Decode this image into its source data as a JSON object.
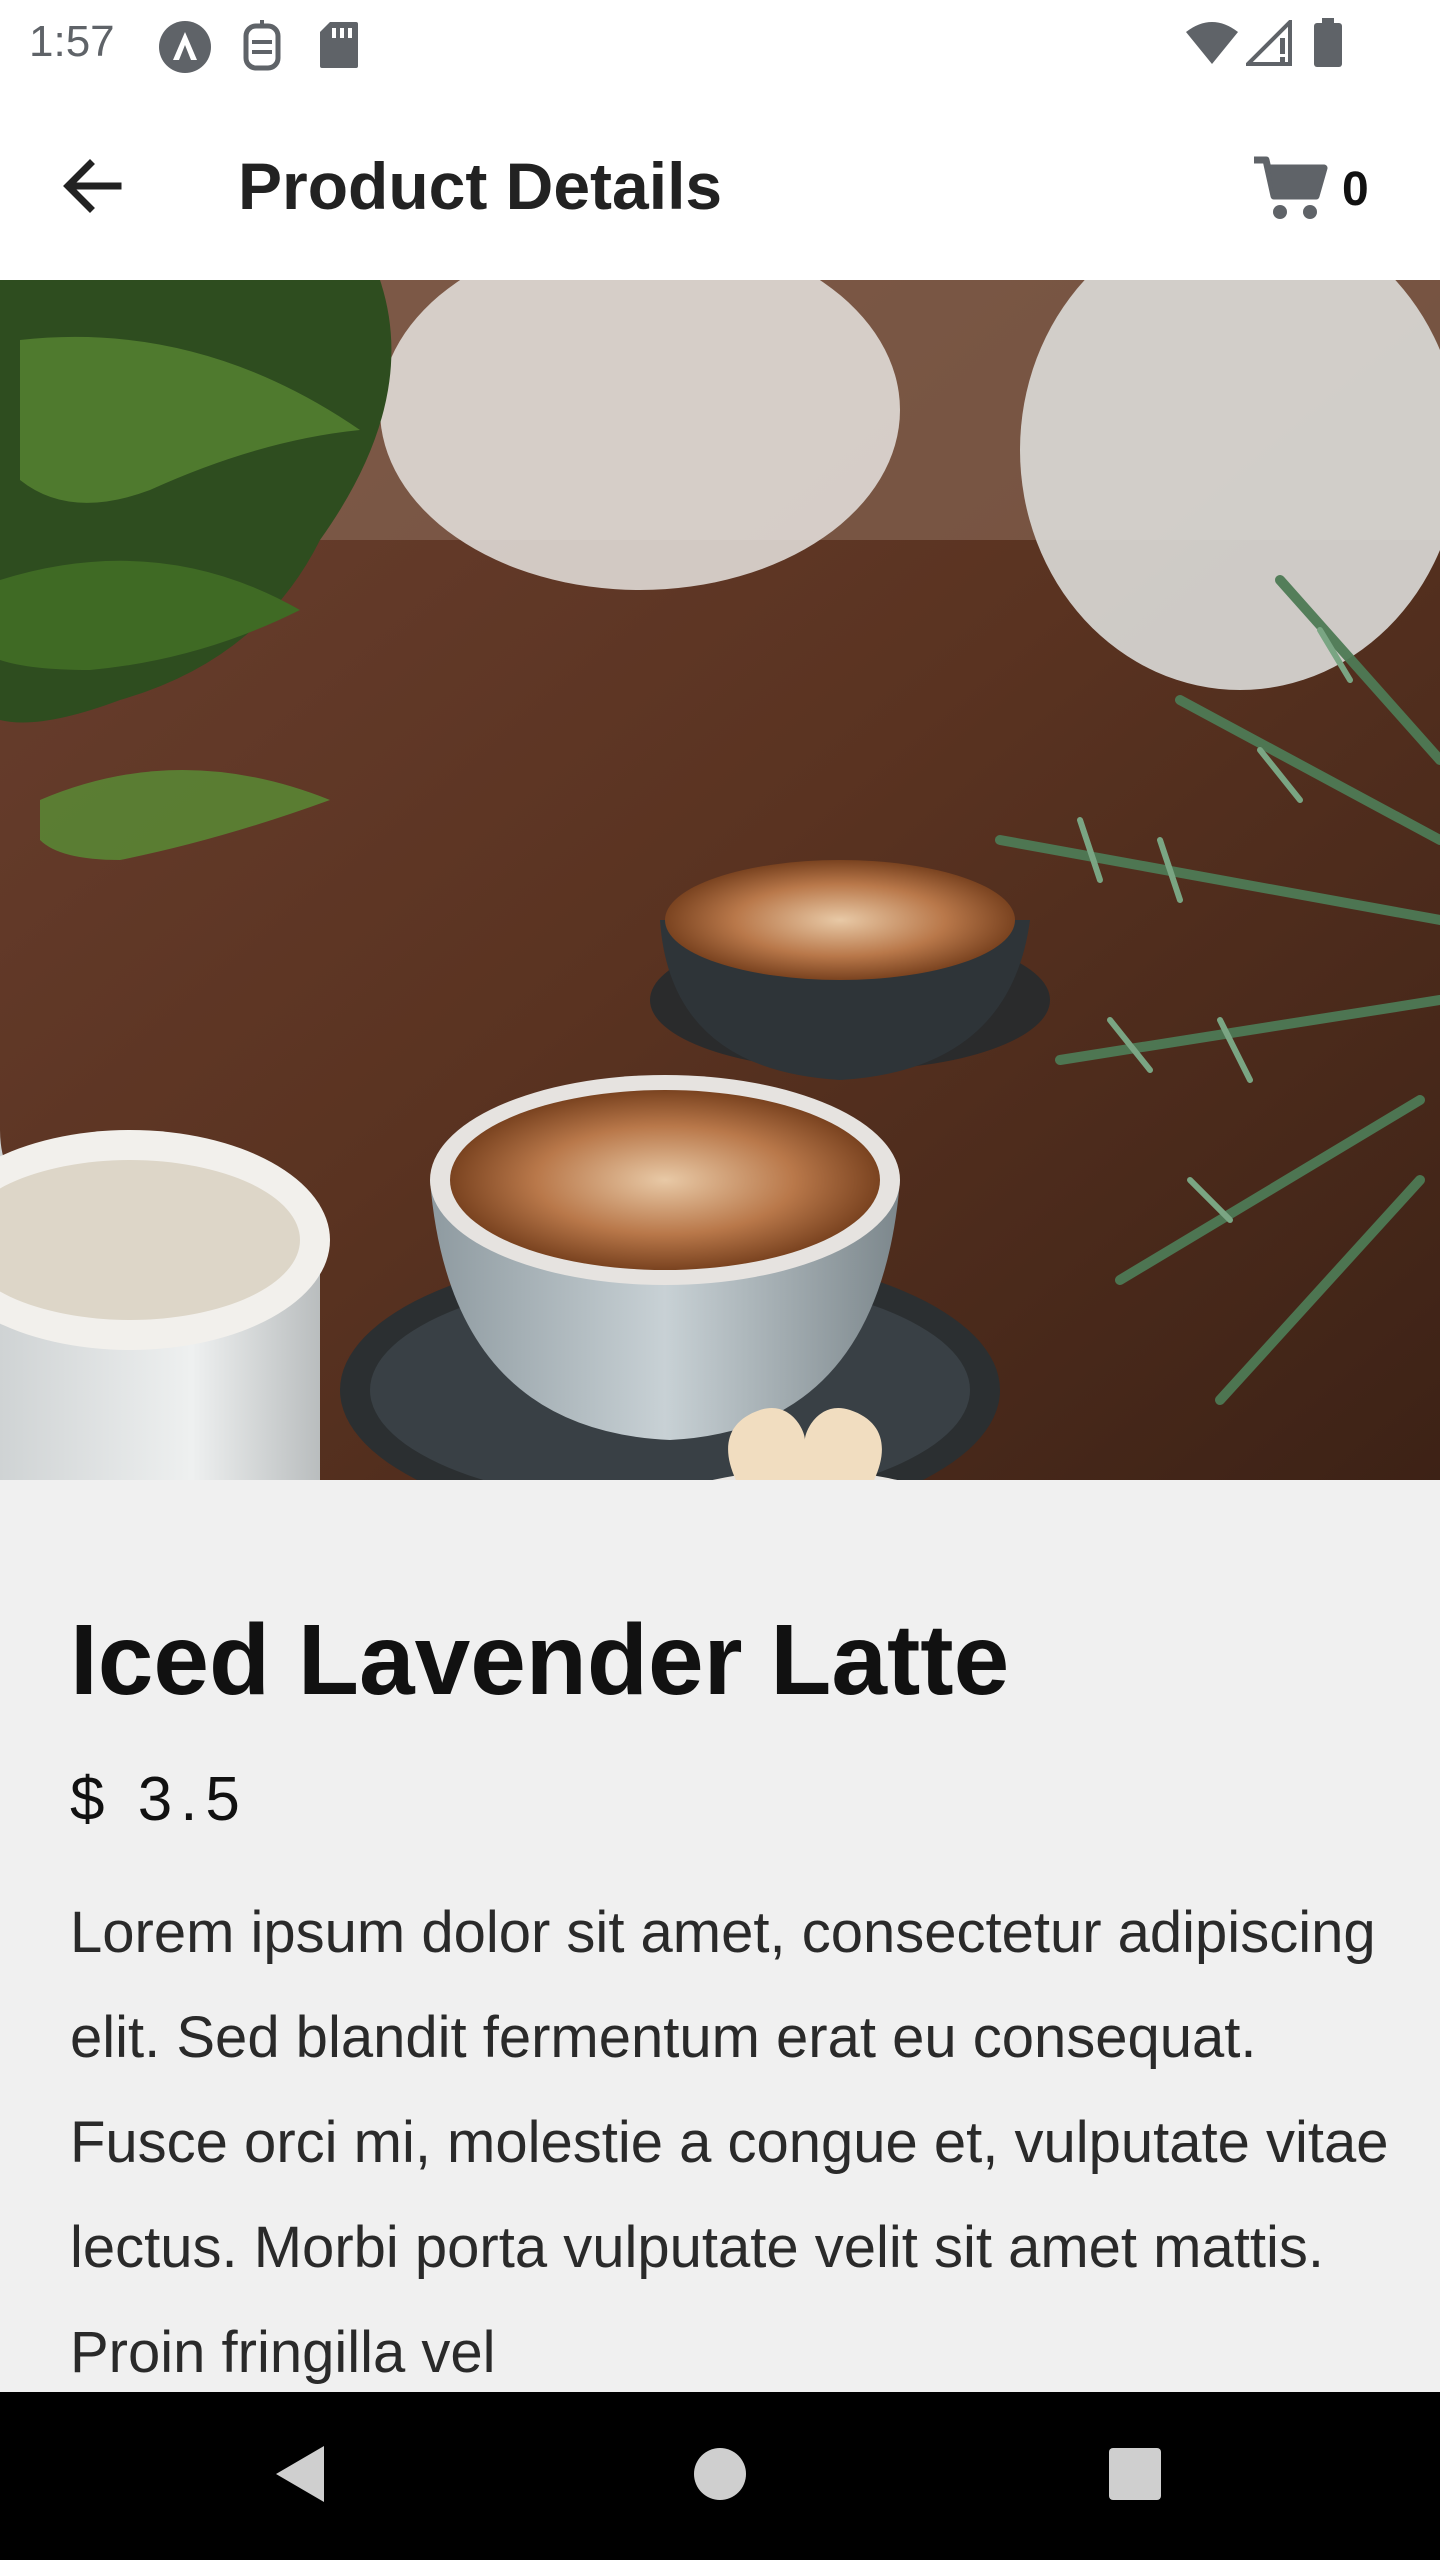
{
  "status_bar": {
    "time": "1:57",
    "icons": [
      "android-auto-icon",
      "sim-toolkit-icon",
      "sd-card-icon",
      "wifi-icon",
      "signal-icon",
      "battery-icon"
    ]
  },
  "app_bar": {
    "title": "Product Details",
    "back_icon": "arrow-back-icon",
    "cart_icon": "shopping-cart-icon",
    "cart_count": "0"
  },
  "product": {
    "image_description": "cups of latte on a wooden table with plants",
    "name": "Iced Lavender Latte",
    "price": "$ 3.5",
    "description": "Lorem ipsum dolor sit amet, consectetur adipiscing elit. Sed blandit fermentum erat eu consequat. Fusce orci mi, molestie a congue et, vulputate vitae lectus. Morbi porta vulputate velit sit amet mattis. Proin fringilla vel"
  },
  "nav_bar": {
    "back": "nav-back-icon",
    "home": "nav-home-icon",
    "recents": "nav-recents-icon"
  },
  "colors": {
    "status_text": "#5f6368",
    "app_bar_bg": "#ffffff",
    "content_bg": "#f0f0f0",
    "nav_bg": "#000000",
    "cart_icon": "#5f6368"
  }
}
